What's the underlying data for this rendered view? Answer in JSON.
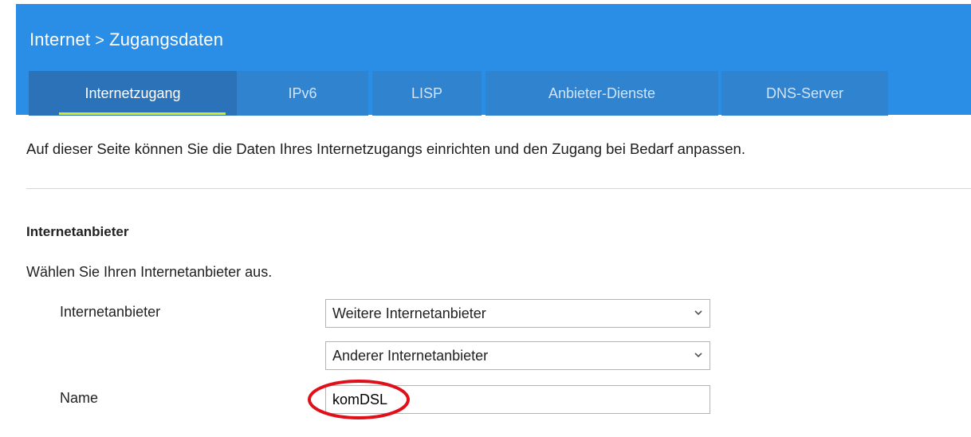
{
  "header": {
    "breadcrumb": {
      "section": "Internet",
      "separator": ">",
      "page": "Zugangsdaten"
    },
    "tabs": [
      {
        "label": "Internetzugang",
        "active": true
      },
      {
        "label": "IPv6",
        "active": false
      },
      {
        "label": "LISP",
        "active": false
      },
      {
        "label": "Anbieter-Dienste",
        "active": false
      },
      {
        "label": "DNS-Server",
        "active": false
      }
    ]
  },
  "main": {
    "intro": "Auf dieser Seite können Sie die Daten Ihres Internetzugangs einrichten und den Zugang bei Bedarf anpassen.",
    "section_title": "Internetanbieter",
    "section_desc": "Wählen Sie Ihren Internetanbieter aus.",
    "fields": {
      "provider_label": "Internetanbieter",
      "provider_select": "Weitere Internetanbieter",
      "provider_sub_select": "Anderer Internetanbieter",
      "name_label": "Name",
      "name_value": "komDSL"
    }
  },
  "colors": {
    "header_bg": "#2a8ee6",
    "active_tab_bg": "#2b72b8",
    "tab_bg": "#2f83cf",
    "active_underline": "#d7e81e",
    "annotation": "#e0101a"
  },
  "icons": {
    "select_arrow": "chevron-down-icon",
    "annotation": "red-circle-highlight"
  }
}
